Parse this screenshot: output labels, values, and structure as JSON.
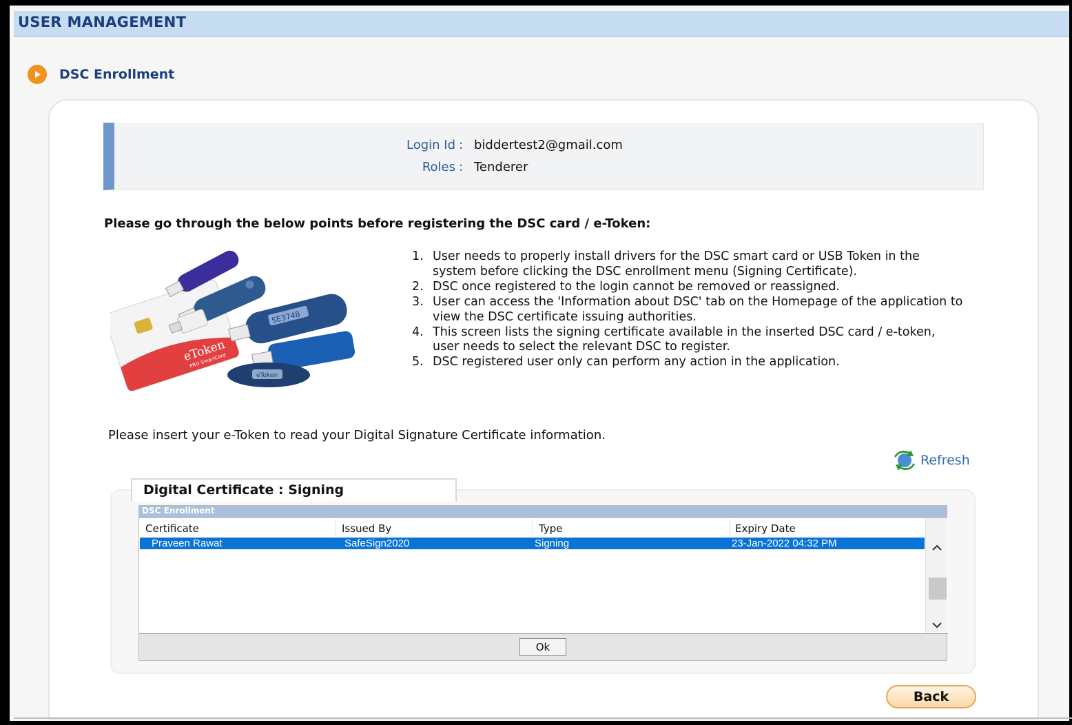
{
  "header": {
    "title": "USER MANAGEMENT"
  },
  "section": {
    "title": "DSC Enrollment",
    "icon": "play-circle-icon"
  },
  "login_info": {
    "login_id_label": "Login Id",
    "login_id_value": "biddertest2@gmail.com",
    "roles_label": "Roles",
    "roles_value": "Tenderer",
    "separator": ":"
  },
  "instructions": {
    "heading": "Please go through the below points before registering the DSC card / e-Token:",
    "points": [
      {
        "num": "1.",
        "text": "User needs to properly install drivers for the DSC smart card or USB Token in the system before clicking the DSC enrollment menu (Signing Certificate)."
      },
      {
        "num": "2.",
        "text": "DSC once registered to the login cannot be removed or reassigned."
      },
      {
        "num": "3.",
        "text": "User can access the 'Information about DSC' tab on the Homepage of the application to view the DSC certificate issuing authorities."
      },
      {
        "num": "4.",
        "text": "This screen lists the signing certificate available in the inserted DSC card / e-token, user needs to select the relevant DSC to register."
      },
      {
        "num": "5.",
        "text": "DSC registered user only can perform any action in the application."
      }
    ]
  },
  "token_image": {
    "card_label": "eToken",
    "card_sublabel": "PRO SmartCard",
    "token_serial": "SE3748",
    "fob_label": "eToken"
  },
  "insert_message": "Please insert your e-Token to read your Digital Signature Certificate information.",
  "refresh": {
    "label": "Refresh",
    "icon": "refresh-icon"
  },
  "certificate_panel": {
    "tab_label": "Digital Certificate : Signing",
    "dialog_title": "DSC Enrollment",
    "columns": [
      "Certificate",
      "Issued By",
      "Type",
      "Expiry Date"
    ],
    "rows": [
      {
        "certificate": "Praveen Rawat",
        "issued_by": "SafeSign2020",
        "type": "Signing",
        "expiry": "23-Jan-2022 04:32 PM",
        "selected": true
      }
    ],
    "ok_label": "Ok"
  },
  "back_label": "Back",
  "colors": {
    "header_bg": "#c6dcf0",
    "header_text": "#1c3f7c",
    "accent_orange": "#f0921c",
    "selection": "#0a73d6",
    "link": "#2f6bb0"
  }
}
